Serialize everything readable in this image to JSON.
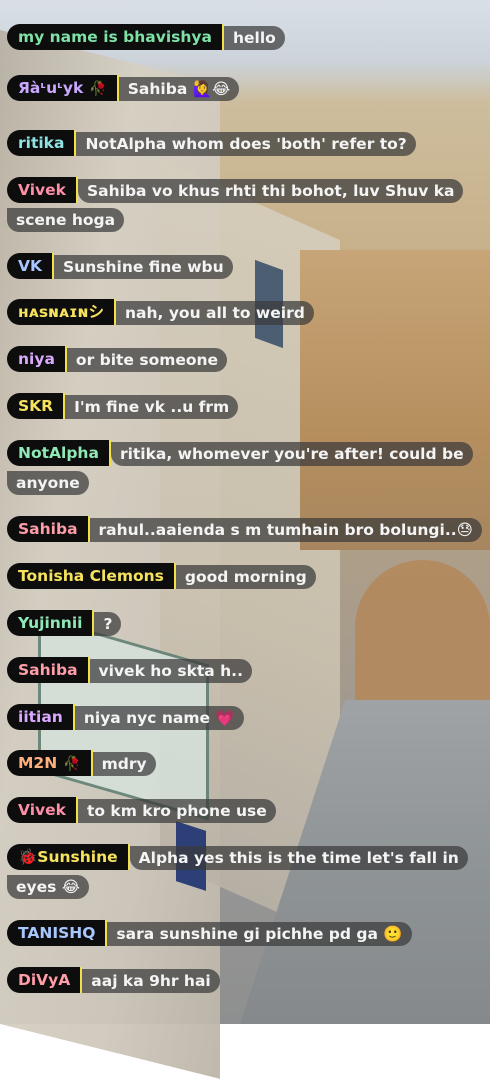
{
  "messages": [
    {
      "user": "my name is bhavishya",
      "color": "#7fe0a6",
      "text": "hello"
    },
    {
      "user": "Яàᶫuᶫуk",
      "color": "#c9a7ff",
      "badge": "🥀",
      "text": "Sahiba 🙋‍♀️😂"
    },
    {
      "user": "ritika",
      "color": "#8fe3e3",
      "text": "NotAlpha whom does 'both' refer to?"
    },
    {
      "user": "Vivek",
      "color": "#ff8fa8",
      "text": "Sahiba vo khus rhti thi bohot, luv Shuv ka scene hoga"
    },
    {
      "user": "VK",
      "color": "#a9c6ff",
      "text": "Sunshine fine wbu"
    },
    {
      "user": "ʜᴀsɴᴀɪɴシ",
      "color": "#f5e25e",
      "text": "nah, you all to weird"
    },
    {
      "user": "niya",
      "color": "#d9a9ff",
      "text": "or bite someone"
    },
    {
      "user": "SKR",
      "color": "#f5e25e",
      "text": "I'm fine vk ..u frm"
    },
    {
      "user": "NotAlpha",
      "color": "#8fe8b5",
      "text": "ritika, whomever you're after! could be anyone"
    },
    {
      "user": "Sahiba",
      "color": "#ff9da8",
      "text": "rahul..aaienda s m tumhain bro bolungi..😓"
    },
    {
      "user": "Tonisha Clemons",
      "color": "#f5e25e",
      "text": "good morning"
    },
    {
      "user": "Yujinnii",
      "color": "#8fe8b5",
      "text": "?"
    },
    {
      "user": "Sahiba",
      "color": "#ff9da8",
      "text": "vivek ho skta h.."
    },
    {
      "user": "iitian",
      "color": "#d9a9ff",
      "text": "niya nyc name 💗"
    },
    {
      "user": "M2N",
      "color": "#ffb07f",
      "badge": "🥀",
      "text": "mdry"
    },
    {
      "user": "Vivek",
      "color": "#ff8fa8",
      "text": "to km kro phone use"
    },
    {
      "user": "🐞Sunshine",
      "color": "#f5e25e",
      "text": "Alpha yes this is the time let's fall in eyes 😂"
    },
    {
      "user": "TANISHQ",
      "color": "#a9c6ff",
      "text": "sara sunshine gi pichhe pd ga 🙂"
    },
    {
      "user": "DiVyA",
      "color": "#ff9da8",
      "text": "aaj ka 9hr hai"
    }
  ]
}
